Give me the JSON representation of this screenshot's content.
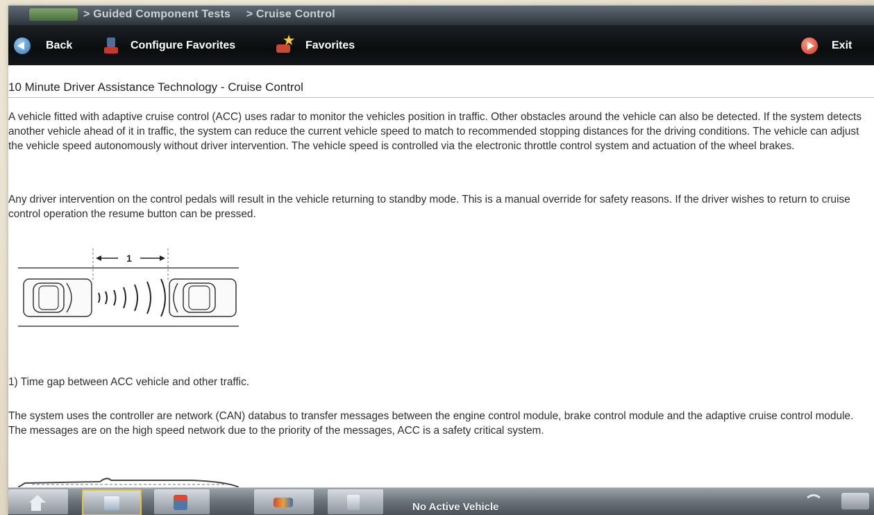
{
  "breadcrumb": {
    "items": [
      "> Guided Component Tests",
      "> Cruise Control"
    ]
  },
  "toolbar": {
    "back_label": "Back",
    "configure_favorites_label": "Configure Favorites",
    "favorites_label": "Favorites",
    "exit_label": "Exit"
  },
  "content": {
    "title": "10 Minute Driver Assistance Technology - Cruise Control",
    "paragraphs": [
      "A vehicle fitted with adaptive cruise control (ACC) uses radar to monitor the vehicles position in traffic. Other obstacles around the vehicle can also be detected. If the system detects another vehicle ahead of it in traffic, the system can reduce the current vehicle speed to match to recommended stopping distances for the driving conditions. The vehicle can adjust the vehicle speed autonomously without driver intervention. The vehicle speed is controlled via the electronic throttle control system and actuation of the wheel brakes.",
      "Any driver intervention on the control pedals will result in the vehicle returning to standby mode. This is a manual override for safety reasons. If the driver wishes to return to cruise control operation the resume button can be pressed.",
      "The system uses the controller are network (CAN) databus to transfer messages between the engine control module, brake control module and the adaptive cruise control module. The messages are on the high speed network due to the priority of the messages, ACC  is a safety critical system."
    ],
    "diagram_callout": "1",
    "caption": "1) Time gap between ACC vehicle and other traffic."
  },
  "bottom_bar": {
    "vehicle_status": "No Active Vehicle",
    "buttons": [
      "home-icon",
      "tests-icon",
      "tools-icon",
      "data-icon",
      "documents-icon"
    ]
  },
  "colors": {
    "toolbar_bg": "#0a0c0d",
    "selected_tab_border": "#e7c23a",
    "back_icon": "#2f79b8",
    "exit_icon": "#d0341e"
  }
}
